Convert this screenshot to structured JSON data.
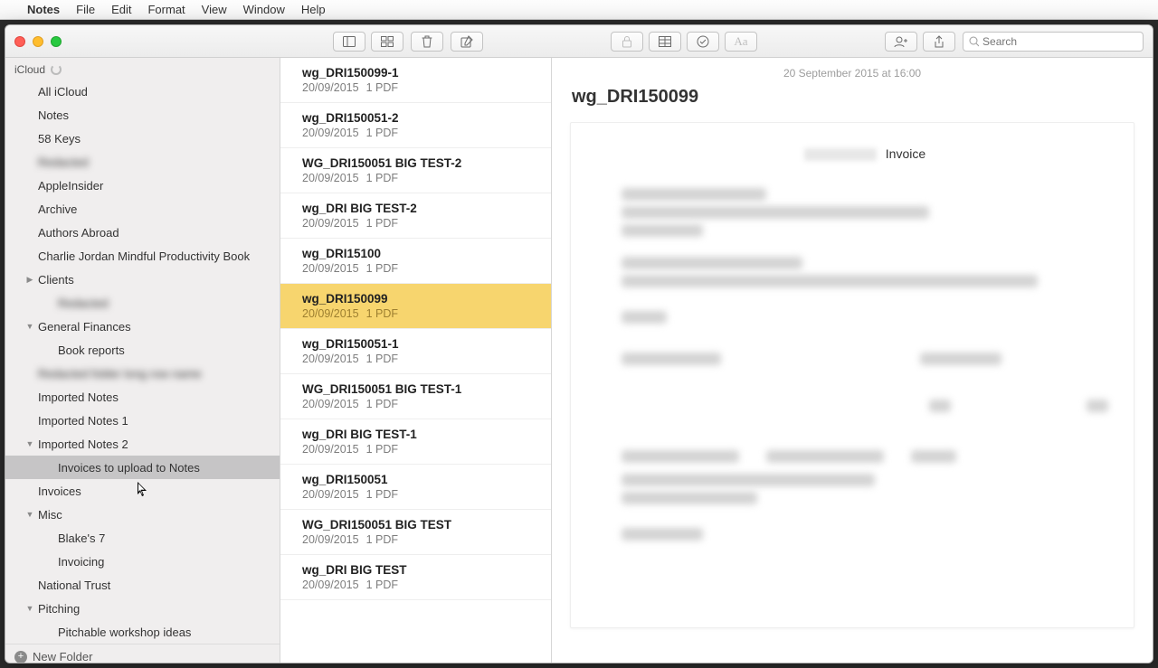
{
  "menubar": {
    "appName": "Notes",
    "items": [
      "File",
      "Edit",
      "Format",
      "View",
      "Window",
      "Help"
    ]
  },
  "toolbar": {
    "searchPlaceholder": "Search"
  },
  "sidebar": {
    "account": "iCloud",
    "items": [
      {
        "label": "All iCloud",
        "indent": 0,
        "disclosure": "",
        "blur": false
      },
      {
        "label": "Notes",
        "indent": 0,
        "disclosure": "",
        "blur": false
      },
      {
        "label": "58 Keys",
        "indent": 0,
        "disclosure": "",
        "blur": false
      },
      {
        "label": "Redacted",
        "indent": 0,
        "disclosure": "",
        "blur": true
      },
      {
        "label": "AppleInsider",
        "indent": 0,
        "disclosure": "",
        "blur": false
      },
      {
        "label": "Archive",
        "indent": 0,
        "disclosure": "",
        "blur": false
      },
      {
        "label": "Authors Abroad",
        "indent": 0,
        "disclosure": "",
        "blur": false
      },
      {
        "label": "Charlie Jordan Mindful Productivity Book",
        "indent": 0,
        "disclosure": "",
        "blur": false
      },
      {
        "label": "Clients",
        "indent": 0,
        "disclosure": "right",
        "blur": false
      },
      {
        "label": "Redacted",
        "indent": 1,
        "disclosure": "",
        "blur": true
      },
      {
        "label": "General Finances",
        "indent": 0,
        "disclosure": "down",
        "blur": false
      },
      {
        "label": "Book reports",
        "indent": 1,
        "disclosure": "",
        "blur": false
      },
      {
        "label": "Redacted folder long row name",
        "indent": 0,
        "disclosure": "",
        "blur": true
      },
      {
        "label": "Imported Notes",
        "indent": 0,
        "disclosure": "",
        "blur": false
      },
      {
        "label": "Imported Notes 1",
        "indent": 0,
        "disclosure": "",
        "blur": false
      },
      {
        "label": "Imported Notes 2",
        "indent": 0,
        "disclosure": "down",
        "blur": false
      },
      {
        "label": "Invoices to upload to Notes",
        "indent": 1,
        "disclosure": "",
        "blur": false,
        "selected": true
      },
      {
        "label": "Invoices",
        "indent": 0,
        "disclosure": "",
        "blur": false
      },
      {
        "label": "Misc",
        "indent": 0,
        "disclosure": "down",
        "blur": false
      },
      {
        "label": "Blake's 7",
        "indent": 1,
        "disclosure": "",
        "blur": false
      },
      {
        "label": "Invoicing",
        "indent": 1,
        "disclosure": "",
        "blur": false
      },
      {
        "label": "National Trust",
        "indent": 0,
        "disclosure": "",
        "blur": false
      },
      {
        "label": "Pitching",
        "indent": 0,
        "disclosure": "down",
        "blur": false
      },
      {
        "label": "Pitchable workshop ideas",
        "indent": 1,
        "disclosure": "",
        "blur": false
      }
    ],
    "newFolder": "New Folder"
  },
  "notes": [
    {
      "title": "wg_DRI150099-1",
      "date": "20/09/2015",
      "att": "1 PDF"
    },
    {
      "title": "wg_DRI150051-2",
      "date": "20/09/2015",
      "att": "1 PDF"
    },
    {
      "title": "WG_DRI150051 BIG TEST-2",
      "date": "20/09/2015",
      "att": "1 PDF"
    },
    {
      "title": "wg_DRI BIG TEST-2",
      "date": "20/09/2015",
      "att": "1 PDF"
    },
    {
      "title": "wg_DRI15100",
      "date": "20/09/2015",
      "att": "1 PDF"
    },
    {
      "title": "wg_DRI150099",
      "date": "20/09/2015",
      "att": "1 PDF",
      "selected": true
    },
    {
      "title": "wg_DRI150051-1",
      "date": "20/09/2015",
      "att": "1 PDF"
    },
    {
      "title": "WG_DRI150051 BIG TEST-1",
      "date": "20/09/2015",
      "att": "1 PDF"
    },
    {
      "title": "wg_DRI BIG TEST-1",
      "date": "20/09/2015",
      "att": "1 PDF"
    },
    {
      "title": "wg_DRI150051",
      "date": "20/09/2015",
      "att": "1 PDF"
    },
    {
      "title": "WG_DRI150051 BIG TEST",
      "date": "20/09/2015",
      "att": "1 PDF"
    },
    {
      "title": "wg_DRI BIG TEST",
      "date": "20/09/2015",
      "att": "1 PDF"
    }
  ],
  "content": {
    "dateline": "20 September 2015 at 16:00",
    "title": "wg_DRI150099",
    "invoiceWord": "Invoice"
  }
}
